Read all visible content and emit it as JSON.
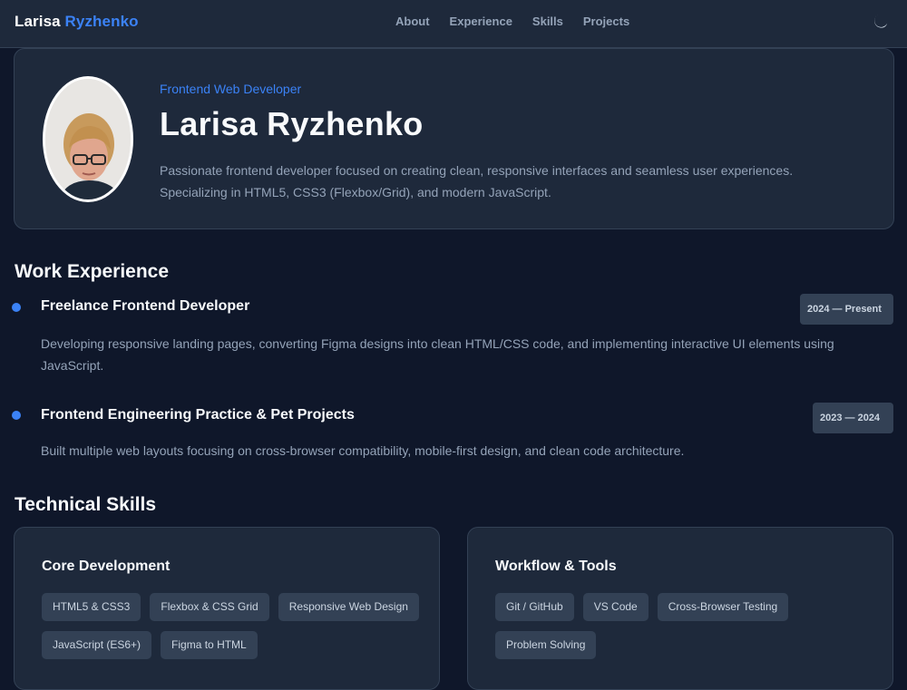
{
  "header": {
    "brand_first": "Larisa",
    "brand_last": "Ryzhenko",
    "nav": [
      {
        "label": "About"
      },
      {
        "label": "Experience"
      },
      {
        "label": "Skills"
      },
      {
        "label": "Projects"
      }
    ],
    "theme_icon": "moon-icon"
  },
  "hero": {
    "role": "Frontend Web Developer",
    "name": "Larisa Ryzhenko",
    "description": "Passionate frontend developer focused on creating clean, responsive interfaces and seamless user experiences. Specializing in HTML5, CSS3 (Flexbox/Grid), and modern JavaScript."
  },
  "experience": {
    "title": "Work Experience",
    "jobs": [
      {
        "title": "Freelance Frontend Developer",
        "date": "2024 — Present",
        "description": "Developing responsive landing pages, converting Figma designs into clean HTML/CSS code, and implementing interactive UI elements using JavaScript."
      },
      {
        "title": "Frontend Engineering Practice & Pet Projects",
        "date": "2023 — 2024",
        "description": "Built multiple web layouts focusing on cross-browser compatibility, mobile-first design, and clean code architecture."
      }
    ]
  },
  "skills": {
    "title": "Technical Skills",
    "groups": [
      {
        "title": "Core Development",
        "tags": [
          "HTML5 & CSS3",
          "Flexbox & CSS Grid",
          "Responsive Web Design",
          "JavaScript (ES6+)",
          "Figma to HTML"
        ]
      },
      {
        "title": "Workflow & Tools",
        "tags": [
          "Git / GitHub",
          "VS Code",
          "Cross-Browser Testing",
          "Problem Solving"
        ]
      }
    ]
  },
  "colors": {
    "background": "#0f172a",
    "card": "#1e293b",
    "accent": "#3b82f6",
    "muted_text": "#94a3b8"
  }
}
